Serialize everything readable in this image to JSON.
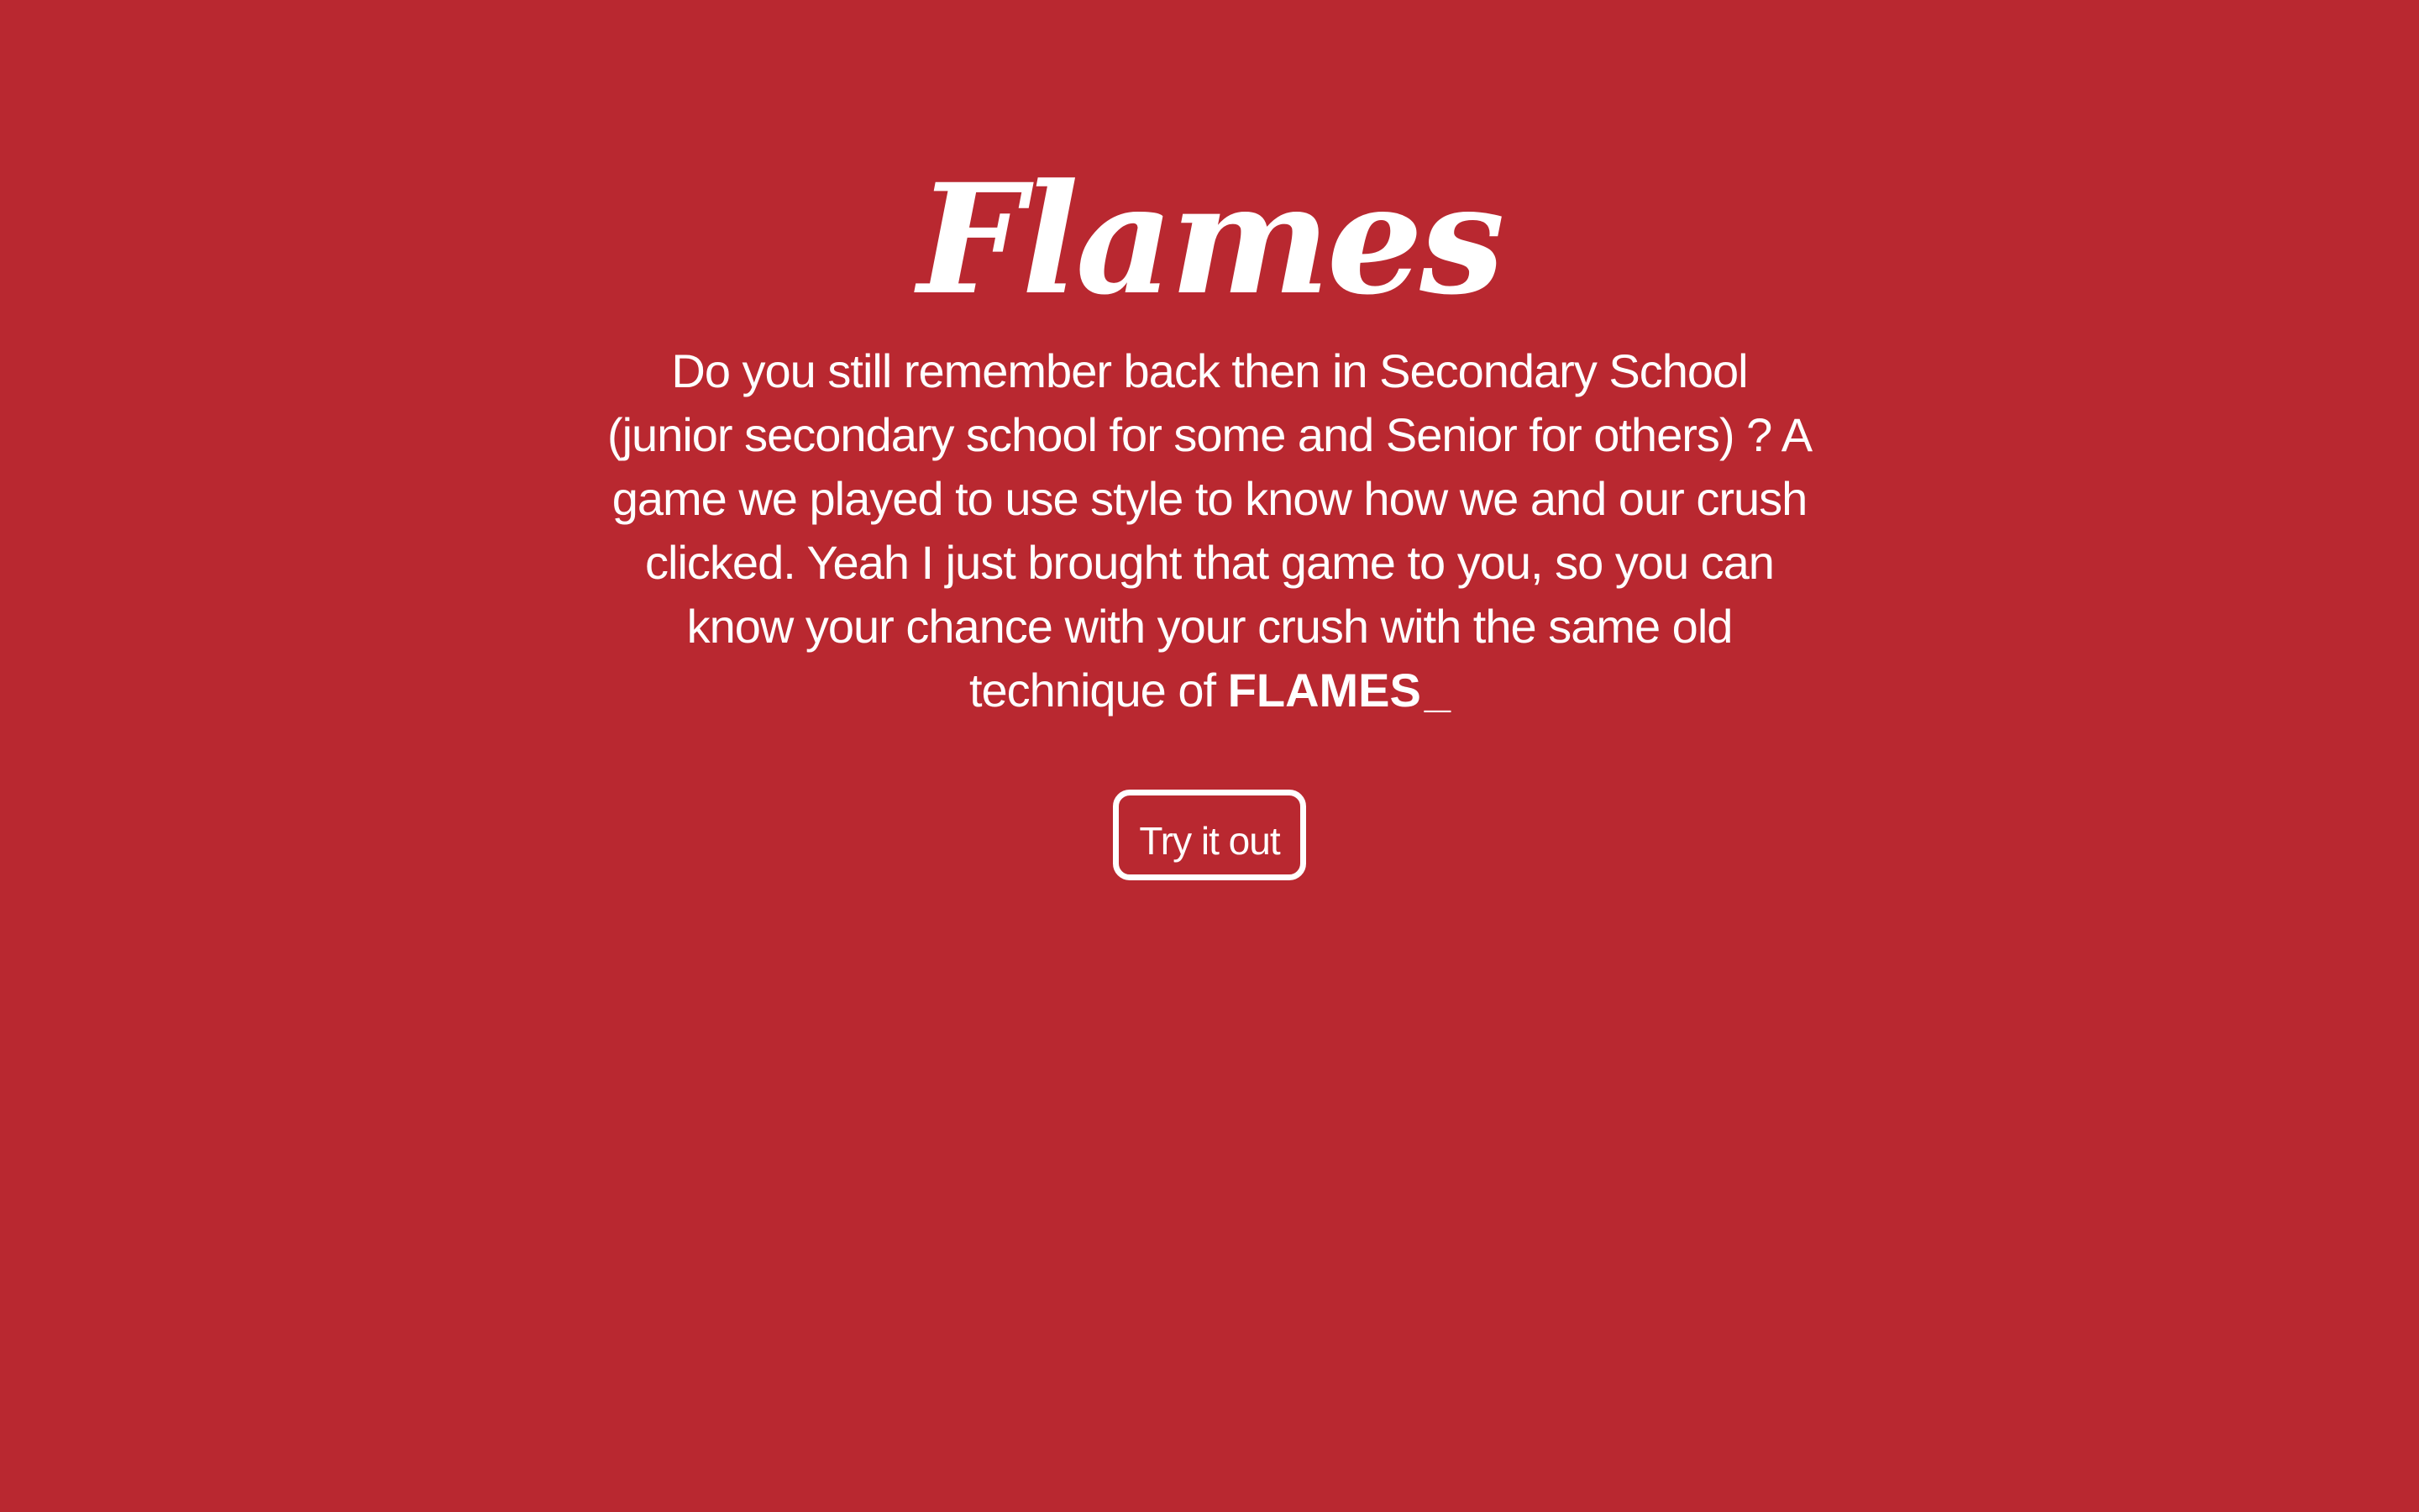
{
  "theme": {
    "background": "#b92830",
    "foreground": "#ffffff"
  },
  "hero": {
    "title": "Flames",
    "description": "Do you still remember back then in Secondary School (junior secondary school for some and Senior for others) ? A game we played to use style to know how we and our crush clicked. Yeah I just brought that game to you, so you can know your chance with your crush with the same old technique of",
    "highlight": "FLAMES",
    "cursor": "_",
    "button_label": "Try it out"
  }
}
